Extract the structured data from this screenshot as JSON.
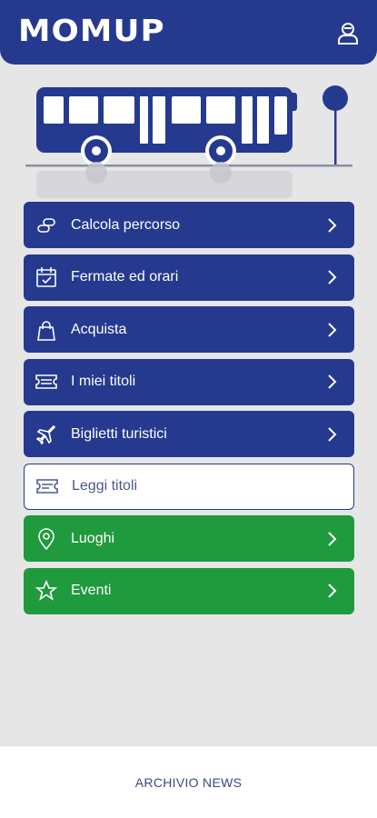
{
  "app": {
    "logo_text": "MOMUP"
  },
  "header": {
    "user_icon": "user-avatar-icon"
  },
  "menu": {
    "items": [
      {
        "label": "Calcola percorso",
        "icon": "route-icon",
        "style": "blue"
      },
      {
        "label": "Fermate ed orari",
        "icon": "calendar-icon",
        "style": "blue"
      },
      {
        "label": "Acquista",
        "icon": "shopping-bag-icon",
        "style": "blue"
      },
      {
        "label": "I miei titoli",
        "icon": "ticket-icon",
        "style": "blue"
      },
      {
        "label": "Biglietti turistici",
        "icon": "airplane-icon",
        "style": "blue"
      },
      {
        "label": "Leggi titoli",
        "icon": "ticket-scan-icon",
        "style": "outline"
      },
      {
        "label": "Luoghi",
        "icon": "location-pin-icon",
        "style": "green"
      },
      {
        "label": "Eventi",
        "icon": "star-icon",
        "style": "green"
      }
    ]
  },
  "footer": {
    "link_label": "ARCHIVIO NEWS"
  },
  "colors": {
    "primary": "#253a8f",
    "green": "#1f9a3d",
    "background": "#e6e6e6"
  }
}
